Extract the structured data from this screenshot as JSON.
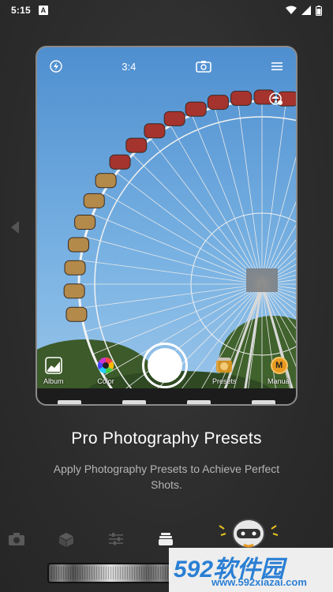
{
  "status_bar": {
    "time": "5:15",
    "notification_letter": "A"
  },
  "camera": {
    "aspect_ratio": "3:4",
    "tools": {
      "album": "Album",
      "color": "Color",
      "presets": "Presets",
      "manual": "Manual",
      "manual_badge": "M"
    }
  },
  "content": {
    "title": "Pro Photography Presets",
    "subtitle": "Apply Photography Presets to Achieve Perfect Shots."
  },
  "watermark": {
    "brand": "592软件园",
    "url": "www.592xiazai.com"
  },
  "colors": {
    "accent_orange": "#e79a1f",
    "sky": "#6aa6dc",
    "watermark_blue": "#2a7fd4"
  },
  "icons": [
    "flash-off-icon",
    "flip-camera-icon",
    "menu-icon",
    "ai-tune-icon",
    "album-icon",
    "color-wheel-icon",
    "presets-icon",
    "manual-icon",
    "camera-tab-icon",
    "cube-tab-icon",
    "sliders-tab-icon",
    "layers-tab-icon"
  ]
}
